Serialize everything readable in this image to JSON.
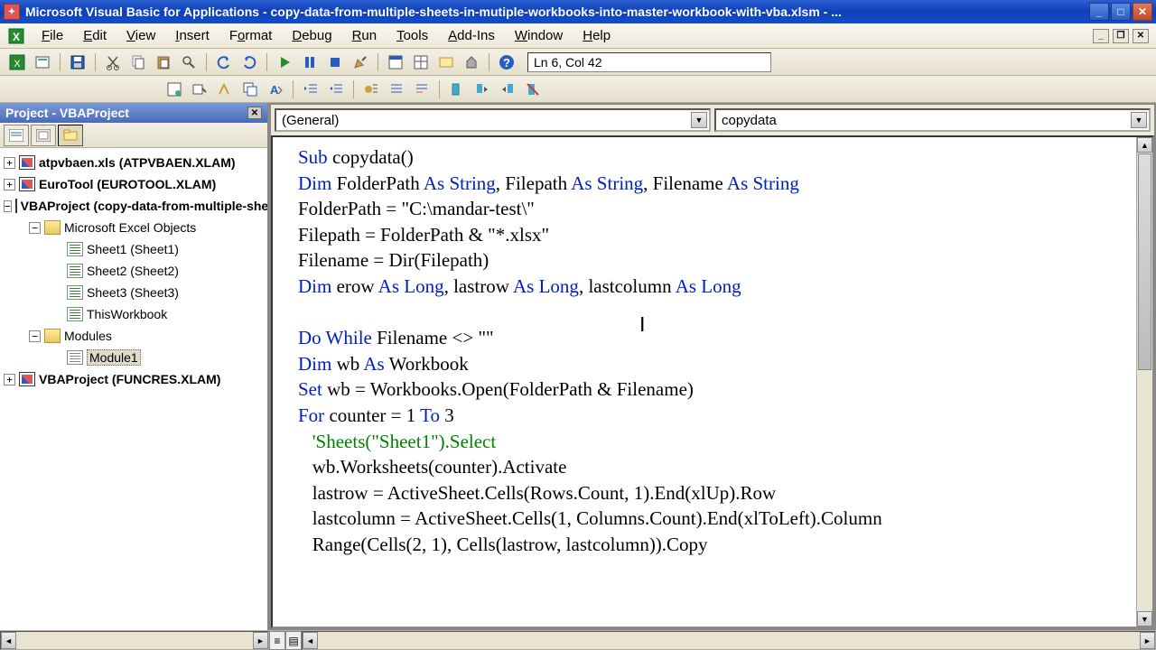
{
  "titlebar": {
    "app": "Microsoft Visual Basic for Applications",
    "doc": "copy-data-from-multiple-sheets-in-mutiple-workbooks-into-master-workbook-with-vba.xlsm - ..."
  },
  "menus": {
    "file": "File",
    "edit": "Edit",
    "view": "View",
    "insert": "Insert",
    "format": "Format",
    "debug": "Debug",
    "run": "Run",
    "tools": "Tools",
    "addins": "Add-Ins",
    "window": "Window",
    "help": "Help"
  },
  "cursor_pos": "Ln 6, Col 42",
  "project_panel": {
    "title": "Project - VBAProject",
    "tree": {
      "p1": "atpvbaen.xls (ATPVBAEN.XLAM)",
      "p2": "EuroTool (EUROTOOL.XLAM)",
      "p3": "VBAProject (copy-data-from-multiple-sheets...)",
      "p3_objs": "Microsoft Excel Objects",
      "p3_s1": "Sheet1 (Sheet1)",
      "p3_s2": "Sheet2 (Sheet2)",
      "p3_s3": "Sheet3 (Sheet3)",
      "p3_tw": "ThisWorkbook",
      "p3_mods": "Modules",
      "p3_m1": "Module1",
      "p4": "VBAProject (FUNCRES.XLAM)"
    }
  },
  "dropdowns": {
    "left": "(General)",
    "right": "copydata"
  },
  "code": {
    "l1a": "Sub",
    "l1b": " copydata()",
    "l2a": "Dim",
    "l2b": " FolderPath ",
    "l2c": "As String",
    "l2d": ", Filepath ",
    "l2e": "As String",
    "l2f": ", Filename ",
    "l2g": "As String",
    "l3": "FolderPath = \"C:\\mandar-test\\\"",
    "l4": "Filepath = FolderPath & \"*.xlsx\"",
    "l5": "Filename = Dir(Filepath)",
    "l6a": "Dim",
    "l6b": " erow ",
    "l6c": "As Long",
    "l6d": ", lastrow ",
    "l6e": "As Long",
    "l6f": ", lastcolumn ",
    "l6g": "As Long",
    "l7": "",
    "l8a": "Do While",
    "l8b": " Filename <> \"\"",
    "l9a": "Dim",
    "l9b": " wb ",
    "l9c": "As",
    "l9d": " Workbook",
    "l10a": "Set",
    "l10b": " wb = Workbooks.Open(FolderPath & Filename)",
    "l11a": "For",
    "l11b": " counter = 1 ",
    "l11c": "To",
    "l11d": " 3",
    "l12": "   'Sheets(\"Sheet1\").Select",
    "l13": "   wb.Worksheets(counter).Activate",
    "l14": "   lastrow = ActiveSheet.Cells(Rows.Count, 1).End(xlUp).Row",
    "l15": "   lastcolumn = ActiveSheet.Cells(1, Columns.Count).End(xlToLeft).Column",
    "l16": "   Range(Cells(2, 1), Cells(lastrow, lastcolumn)).Copy"
  }
}
